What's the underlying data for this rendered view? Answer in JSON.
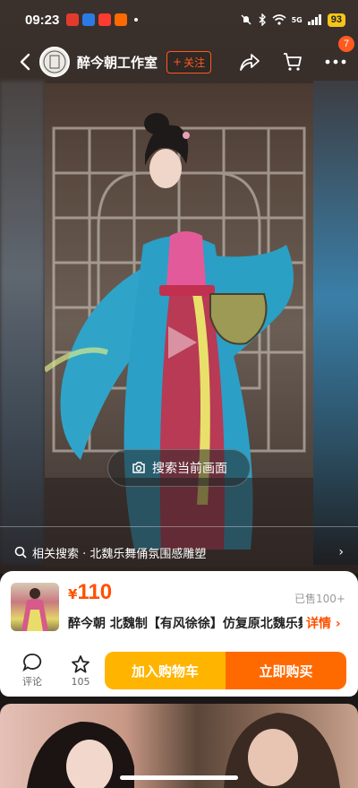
{
  "status_bar": {
    "time": "09:23",
    "network": "5G",
    "battery": "93"
  },
  "header": {
    "shop_name": "醉今朝工作室",
    "avatar_text": "醉今朝",
    "follow_label": "关注",
    "cart_badge": "7"
  },
  "video": {
    "search_frame_label": "搜索当前画面",
    "related_search": "相关搜索 · 北魏乐舞俑氛围感雕塑"
  },
  "product": {
    "currency": "¥",
    "price": "110",
    "sold": "已售100+",
    "title": "醉今朝 北魏制【有风徐徐】仿复原北魏乐舞俑",
    "details_label": "详情"
  },
  "actions": {
    "comment_label": "评论",
    "favorite_count": "105",
    "add_to_cart": "加入购物车",
    "buy_now": "立即购买"
  },
  "colors": {
    "accent": "#ff5000",
    "cart_button": "#ffb400",
    "buy_button": "#ff6a00"
  }
}
